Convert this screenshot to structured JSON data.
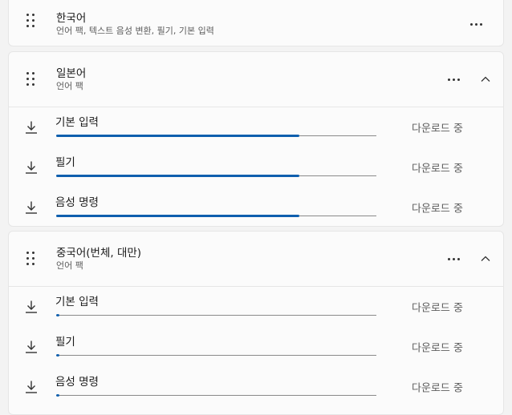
{
  "packs": [
    {
      "title": "한국어",
      "subtitle": "언어 팩, 텍스트 음성 변환, 필기, 기본 입력"
    },
    {
      "title": "일본어",
      "subtitle": "언어 팩",
      "items": [
        {
          "label": "기본 입력",
          "status": "다운로드 중",
          "progress": 0.76
        },
        {
          "label": "필기",
          "status": "다운로드 중",
          "progress": 0.76
        },
        {
          "label": "음성 명령",
          "status": "다운로드 중",
          "progress": 0.76
        }
      ]
    },
    {
      "title": "중국어(번체, 대만)",
      "subtitle": "언어 팩",
      "items": [
        {
          "label": "기본 입력",
          "status": "다운로드 중",
          "progress": 0.01
        },
        {
          "label": "필기",
          "status": "다운로드 중",
          "progress": 0.01
        },
        {
          "label": "음성 명령",
          "status": "다운로드 중",
          "progress": 0.01
        }
      ]
    }
  ],
  "icons": {
    "drag": "drag-handle-icon",
    "more": "more-options-icon",
    "collapse": "chevron-up-icon",
    "download": "download-icon"
  },
  "colors": {
    "progress_fill": "#0f5fae",
    "track": "#8a8a8a",
    "card_bg": "#fbfbfb",
    "page_bg": "#f3f3f3"
  }
}
